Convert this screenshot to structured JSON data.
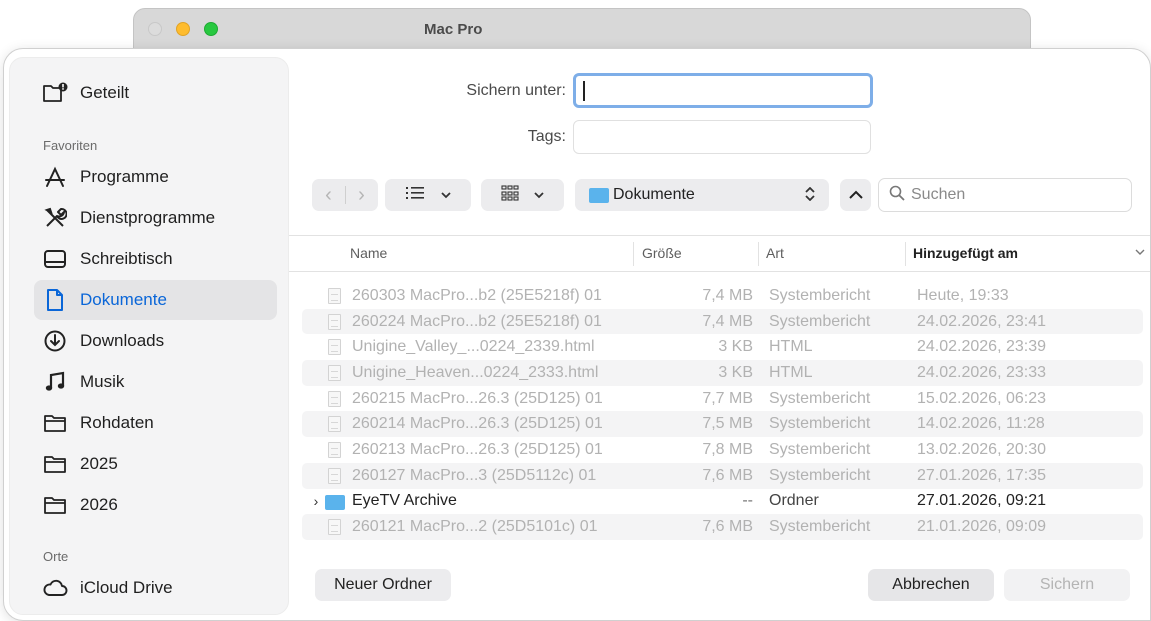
{
  "background_window": {
    "title": "Mac Pro"
  },
  "sidebar": {
    "shared": {
      "label": "Geteilt",
      "icon": "shared-folder-icon"
    },
    "favorites_header": "Favoriten",
    "favorites": [
      {
        "label": "Programme",
        "icon": "applications-icon"
      },
      {
        "label": "Dienstprogramme",
        "icon": "utilities-icon"
      },
      {
        "label": "Schreibtisch",
        "icon": "desktop-icon"
      },
      {
        "label": "Dokumente",
        "icon": "document-icon",
        "selected": true
      },
      {
        "label": "Downloads",
        "icon": "download-icon"
      },
      {
        "label": "Musik",
        "icon": "music-icon"
      },
      {
        "label": "Rohdaten",
        "icon": "folder-icon"
      },
      {
        "label": "2025",
        "icon": "folder-icon"
      },
      {
        "label": "2026",
        "icon": "folder-icon"
      }
    ],
    "places_header": "Orte",
    "places": [
      {
        "label": "iCloud Drive",
        "icon": "cloud-icon"
      }
    ]
  },
  "form": {
    "save_as_label": "Sichern unter:",
    "save_as_value": "",
    "tags_label": "Tags:",
    "tags_value": ""
  },
  "toolbar": {
    "back_glyph": "‹",
    "forward_glyph": "›",
    "list_view_icon": "list-view-icon",
    "grid_view_icon": "grid-view-icon",
    "location": "Dokumente",
    "search_placeholder": "Suchen"
  },
  "table": {
    "columns": [
      "Name",
      "Größe",
      "Art",
      "Hinzugefügt am"
    ],
    "sorted_column": "Hinzugefügt am",
    "rows": [
      {
        "name": "260303 MacPro...b2 (25E5218f) 01",
        "size": "7,4 MB",
        "kind": "Systembericht",
        "date": "Heute, 19:33",
        "enabled": false,
        "type": "doc"
      },
      {
        "name": "260224 MacPro...b2 (25E5218f) 01",
        "size": "7,4 MB",
        "kind": "Systembericht",
        "date": "24.02.2026, 23:41",
        "enabled": false,
        "type": "doc"
      },
      {
        "name": "Unigine_Valley_...0224_2339.html",
        "size": "3 KB",
        "kind": "HTML",
        "date": "24.02.2026, 23:39",
        "enabled": false,
        "type": "doc"
      },
      {
        "name": "Unigine_Heaven...0224_2333.html",
        "size": "3 KB",
        "kind": "HTML",
        "date": "24.02.2026, 23:33",
        "enabled": false,
        "type": "doc"
      },
      {
        "name": "260215 MacPro...26.3 (25D125) 01",
        "size": "7,7 MB",
        "kind": "Systembericht",
        "date": "15.02.2026, 06:23",
        "enabled": false,
        "type": "doc"
      },
      {
        "name": "260214 MacPro...26.3 (25D125) 01",
        "size": "7,5 MB",
        "kind": "Systembericht",
        "date": "14.02.2026, 11:28",
        "enabled": false,
        "type": "doc"
      },
      {
        "name": "260213 MacPro...26.3 (25D125) 01",
        "size": "7,8 MB",
        "kind": "Systembericht",
        "date": "13.02.2026, 20:30",
        "enabled": false,
        "type": "doc"
      },
      {
        "name": "260127 MacPro...3 (25D5112c) 01",
        "size": "7,6 MB",
        "kind": "Systembericht",
        "date": "27.01.2026, 17:35",
        "enabled": false,
        "type": "doc"
      },
      {
        "name": "EyeTV Archive",
        "size": "--",
        "kind": "Ordner",
        "date": "27.01.2026, 09:21",
        "enabled": true,
        "type": "folder"
      },
      {
        "name": "260121 MacPro...2 (25D5101c) 01",
        "size": "7,6 MB",
        "kind": "Systembericht",
        "date": "21.01.2026, 09:09",
        "enabled": false,
        "type": "doc"
      }
    ]
  },
  "buttons": {
    "new_folder": "Neuer Ordner",
    "cancel": "Abbrechen",
    "save": "Sichern"
  },
  "colors": {
    "accent": "#0a66d8",
    "folder_blue": "#5ab3ec",
    "traffic_yellow": "#febc2e",
    "traffic_green": "#28c840"
  }
}
